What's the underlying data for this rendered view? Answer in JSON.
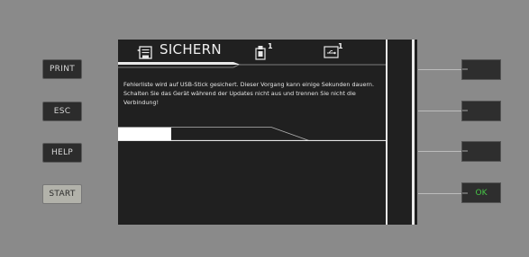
{
  "left_buttons": {
    "print": "PRINT",
    "esc": "ESC",
    "help": "HELP",
    "start": "START"
  },
  "header": {
    "title": "SICHERN",
    "usb_count": "1",
    "stick_count": "1"
  },
  "message": "Fehlerliste wird auf USB-Stick gesichert. Dieser Vorgang kann einige Sekunden dauern. Schalten Sie das Gerät während der Updates nicht aus und trennen Sie nicht die Verbindung!",
  "progress": {
    "fraction": 0.2
  },
  "right_buttons": {
    "b1": "",
    "b2": "",
    "b3": "",
    "ok": "OK"
  },
  "colors": {
    "ok_text": "#46c646",
    "screen_bg": "#202020",
    "bezel": "#8a8a8a"
  }
}
